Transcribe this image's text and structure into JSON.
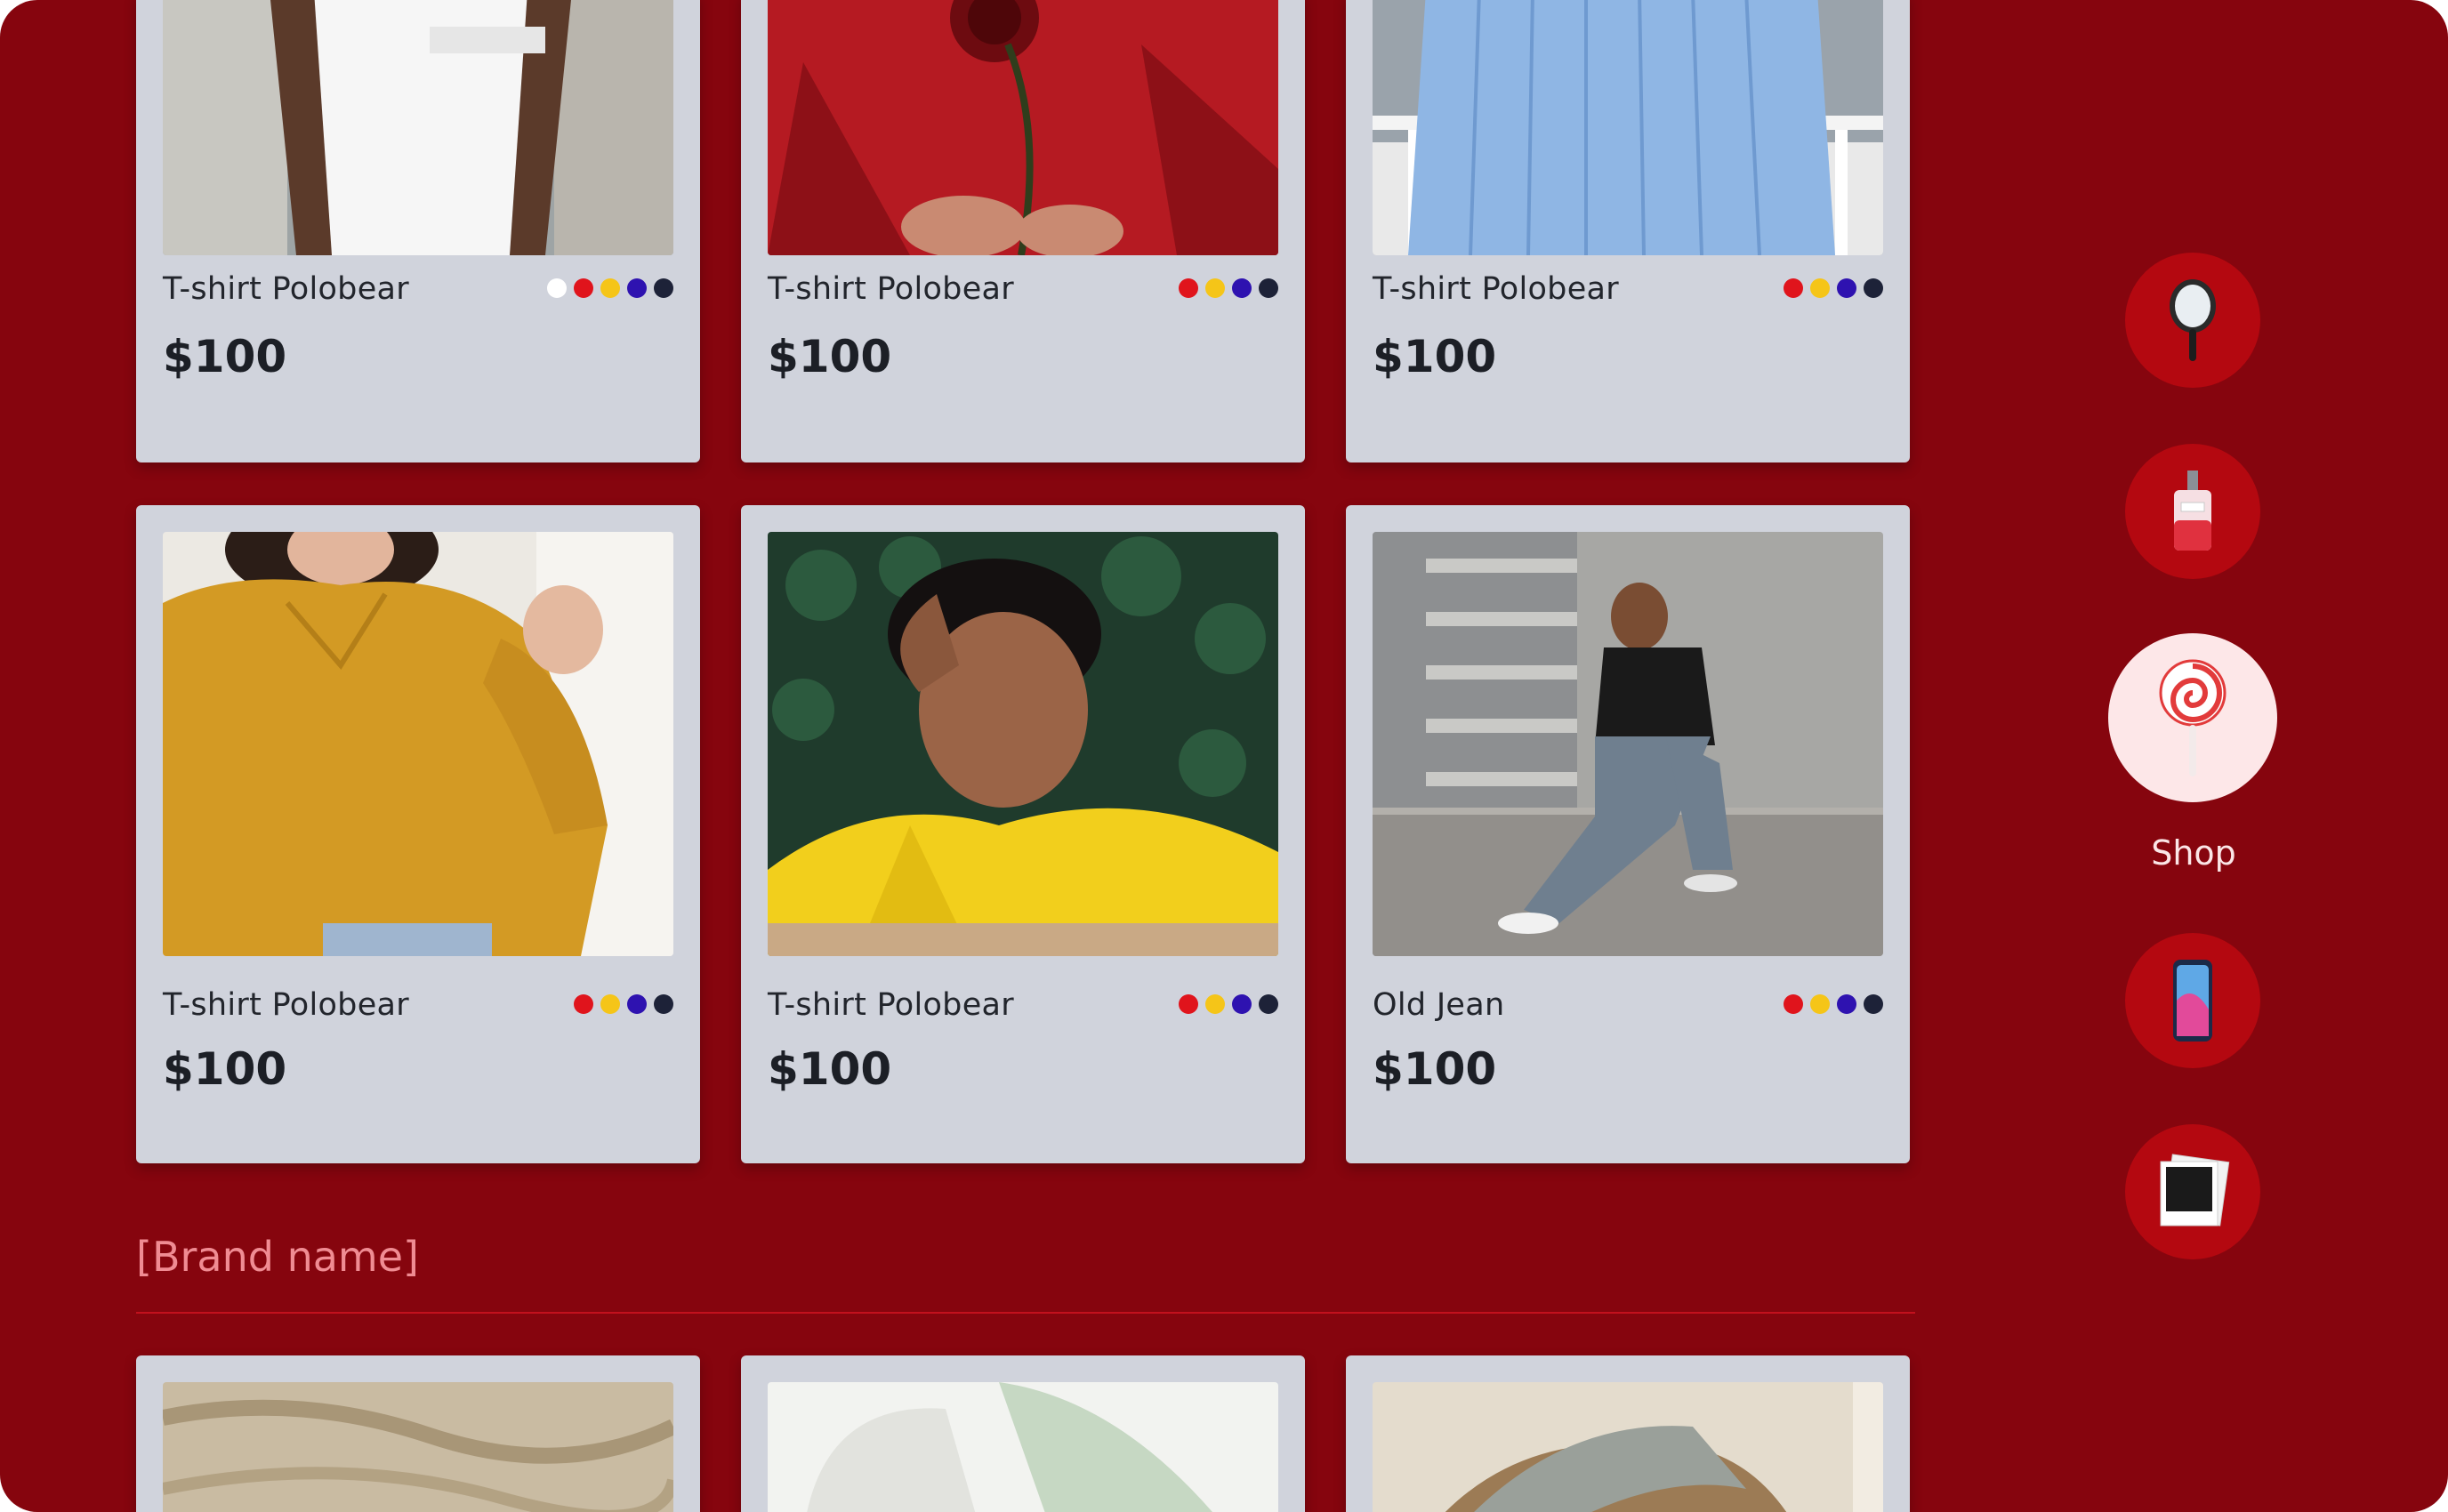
{
  "products": [
    {
      "name": "T-shirt Polobear",
      "price": "$100",
      "colors": [
        "#ffffff",
        "#e0141c",
        "#f5c518",
        "#2e12b0",
        "#1d2238"
      ]
    },
    {
      "name": "T-shirt Polobear",
      "price": "$100",
      "colors": [
        "#e0141c",
        "#f5c518",
        "#2e12b0",
        "#1d2238"
      ]
    },
    {
      "name": "T-shirt Polobear",
      "price": "$100",
      "colors": [
        "#e0141c",
        "#f5c518",
        "#2e12b0",
        "#1d2238"
      ]
    },
    {
      "name": "T-shirt Polobear",
      "price": "$100",
      "colors": [
        "#e0141c",
        "#f5c518",
        "#2e12b0",
        "#1d2238"
      ]
    },
    {
      "name": "T-shirt Polobear",
      "price": "$100",
      "colors": [
        "#e0141c",
        "#f5c518",
        "#2e12b0",
        "#1d2238"
      ]
    },
    {
      "name": "Old Jean",
      "price": "$100",
      "colors": [
        "#e0141c",
        "#f5c518",
        "#2e12b0",
        "#1d2238"
      ]
    }
  ],
  "section": {
    "brand_name": "[Brand name]"
  },
  "categories": [
    {
      "icon": "hand-mirror-icon",
      "label": ""
    },
    {
      "icon": "perfume-icon",
      "label": ""
    },
    {
      "icon": "lollipop-icon",
      "label": "Shop",
      "active": true
    },
    {
      "icon": "phone-icon",
      "label": ""
    },
    {
      "icon": "photos-icon",
      "label": ""
    }
  ],
  "colors": {
    "background": "#86050e",
    "card": "#d0d3dc",
    "accent": "#b40810",
    "active_bg": "#fde7e8",
    "brand_text": "#f08c93"
  }
}
